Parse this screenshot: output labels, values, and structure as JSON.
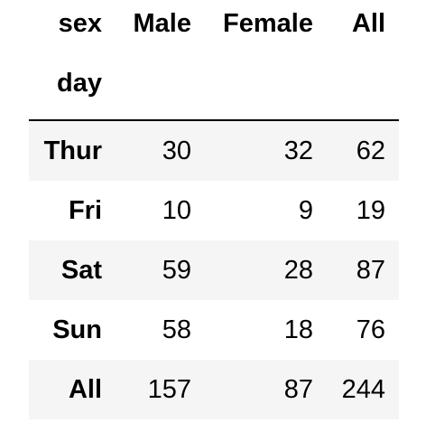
{
  "table": {
    "columns_name": "sex",
    "index_name": "day",
    "columns": [
      "Male",
      "Female",
      "All"
    ],
    "rows": [
      {
        "label": "Thur",
        "values": [
          "30",
          "32",
          "62"
        ]
      },
      {
        "label": "Fri",
        "values": [
          "10",
          "9",
          "19"
        ]
      },
      {
        "label": "Sat",
        "values": [
          "59",
          "28",
          "87"
        ]
      },
      {
        "label": "Sun",
        "values": [
          "58",
          "18",
          "76"
        ]
      },
      {
        "label": "All",
        "values": [
          "157",
          "87",
          "244"
        ]
      }
    ]
  }
}
